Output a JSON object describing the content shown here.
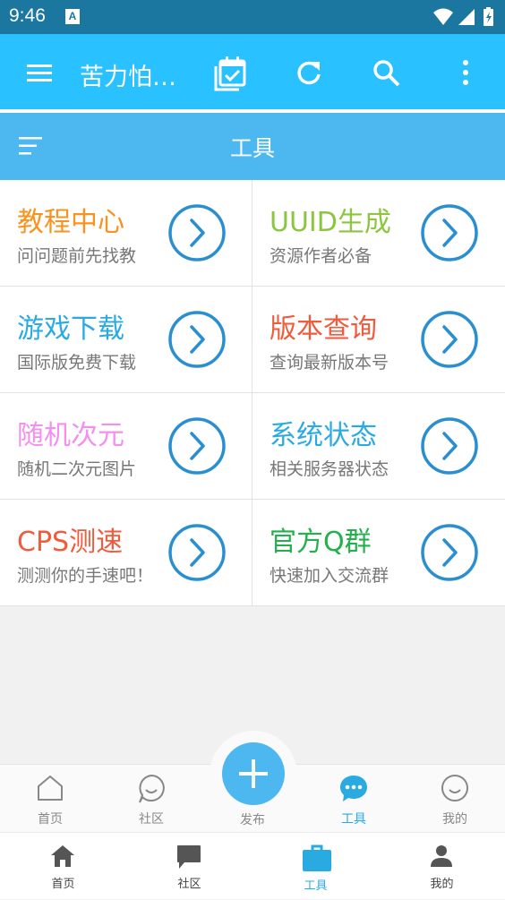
{
  "status_bar": {
    "time": "9:46",
    "notification_letter": "A"
  },
  "app_bar": {
    "title": "苦力怕…",
    "icons": [
      "menu-icon",
      "calendar-check-icon",
      "refresh-icon",
      "search-icon",
      "more-vertical-icon"
    ]
  },
  "section": {
    "title": "工具",
    "icon": "sort-lines-icon"
  },
  "tools": [
    {
      "title": "教程中心",
      "subtitle": "问问题前先找教",
      "color": "#f7931e"
    },
    {
      "title": "UUID生成",
      "subtitle": "资源作者必备",
      "color": "#8cc63f"
    },
    {
      "title": "游戏下载",
      "subtitle": "国际版免费下载",
      "color": "#29abe2"
    },
    {
      "title": "版本查询",
      "subtitle": "查询最新版本号",
      "color": "#f15a3b"
    },
    {
      "title": "随机次元",
      "subtitle": "随机二次元图片",
      "color": "#f38ff0"
    },
    {
      "title": "系统状态",
      "subtitle": "相关服务器状态",
      "color": "#29abe2"
    },
    {
      "title": "CPS测速",
      "subtitle": "测测你的手速吧！",
      "color": "#f15a3b"
    },
    {
      "title": "官方Q群",
      "subtitle": "快速加入交流群",
      "color": "#22b14c"
    }
  ],
  "nav_primary": {
    "items": [
      {
        "label": "首页",
        "icon": "home-outline-icon"
      },
      {
        "label": "社区",
        "icon": "chat-smile-icon"
      },
      {
        "label": "发布",
        "icon": "plus-icon"
      },
      {
        "label": "工具",
        "icon": "chat-dots-icon",
        "active": true
      },
      {
        "label": "我的",
        "icon": "smile-icon"
      }
    ],
    "active_color": "#29abe2"
  },
  "nav_secondary": {
    "items": [
      {
        "label": "首页",
        "icon": "home-filled-icon"
      },
      {
        "label": "社区",
        "icon": "chat-bubble-icon"
      },
      {
        "label": "工具",
        "icon": "briefcase-icon",
        "active": true
      },
      {
        "label": "我的",
        "icon": "person-icon"
      }
    ],
    "active_color": "#29abe2"
  }
}
